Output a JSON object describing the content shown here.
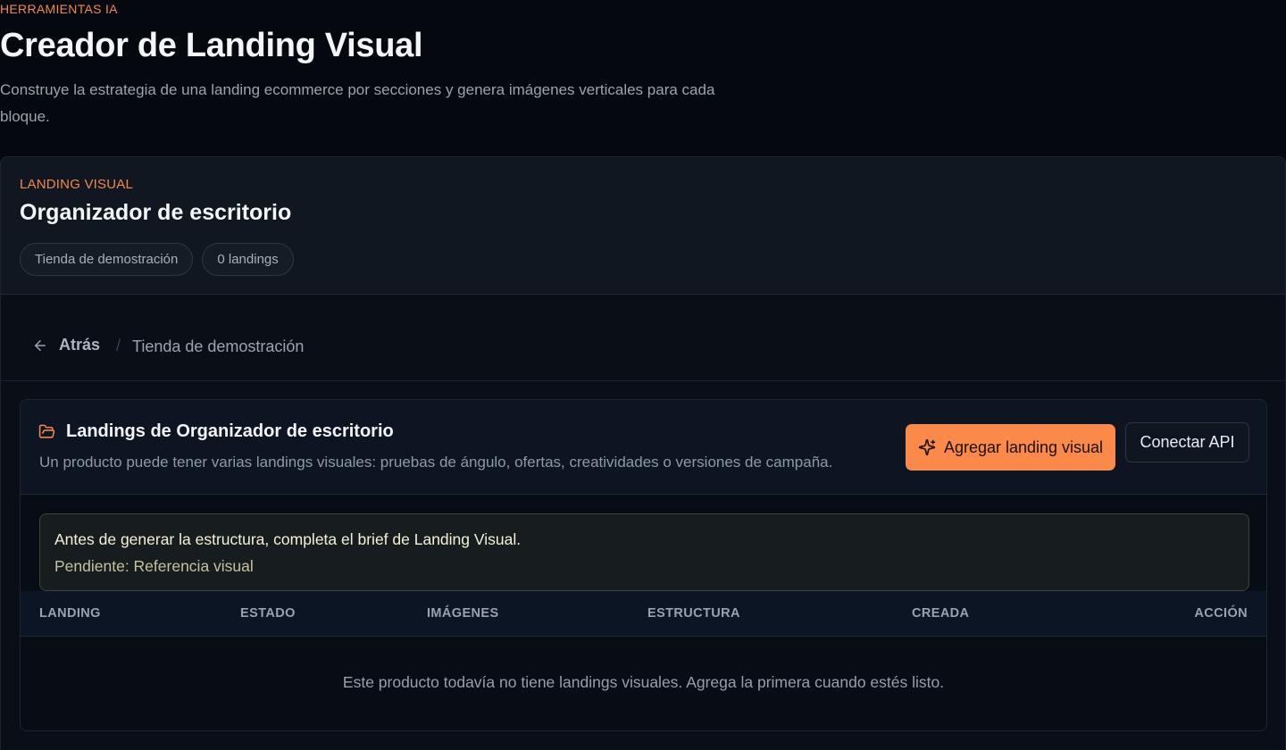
{
  "header": {
    "eyebrow": "HERRAMIENTAS IA",
    "title": "Creador de Landing Visual",
    "description": "Construye la estrategia de una landing ecommerce por secciones y genera imágenes verticales para cada bloque."
  },
  "product_card": {
    "eyebrow": "LANDING VISUAL",
    "title": "Organizador de escritorio",
    "chips": [
      "Tienda de demostración",
      "0 landings"
    ]
  },
  "breadcrumb": {
    "back_label": "Atrás",
    "separator": "/",
    "current": "Tienda de demostración"
  },
  "landings_panel": {
    "title": "Landings de Organizador de escritorio",
    "subtitle": "Un producto puede tener varias landings visuales: pruebas de ángulo, ofertas, creatividades o versiones de campaña.",
    "primary_button": "Agregar landing visual",
    "secondary_button": "Conectar API",
    "alert": {
      "title": "Antes de generar la estructura, completa el brief de Landing Visual.",
      "detail": "Pendiente: Referencia visual"
    },
    "table": {
      "columns": [
        "LANDING",
        "ESTADO",
        "IMÁGENES",
        "ESTRUCTURA",
        "CREADA",
        "ACCIÓN"
      ],
      "rows": [],
      "empty_message": "Este producto todavía no tiene landings visuales. Agrega la primera cuando estés listo."
    }
  },
  "icons": {
    "back": "arrow-left-icon",
    "folder": "folder-open-icon",
    "sparkles": "sparkles-icon"
  },
  "colors": {
    "accent": "#f0884f",
    "primary_button": "#fb8a4a",
    "background": "#05080e"
  }
}
